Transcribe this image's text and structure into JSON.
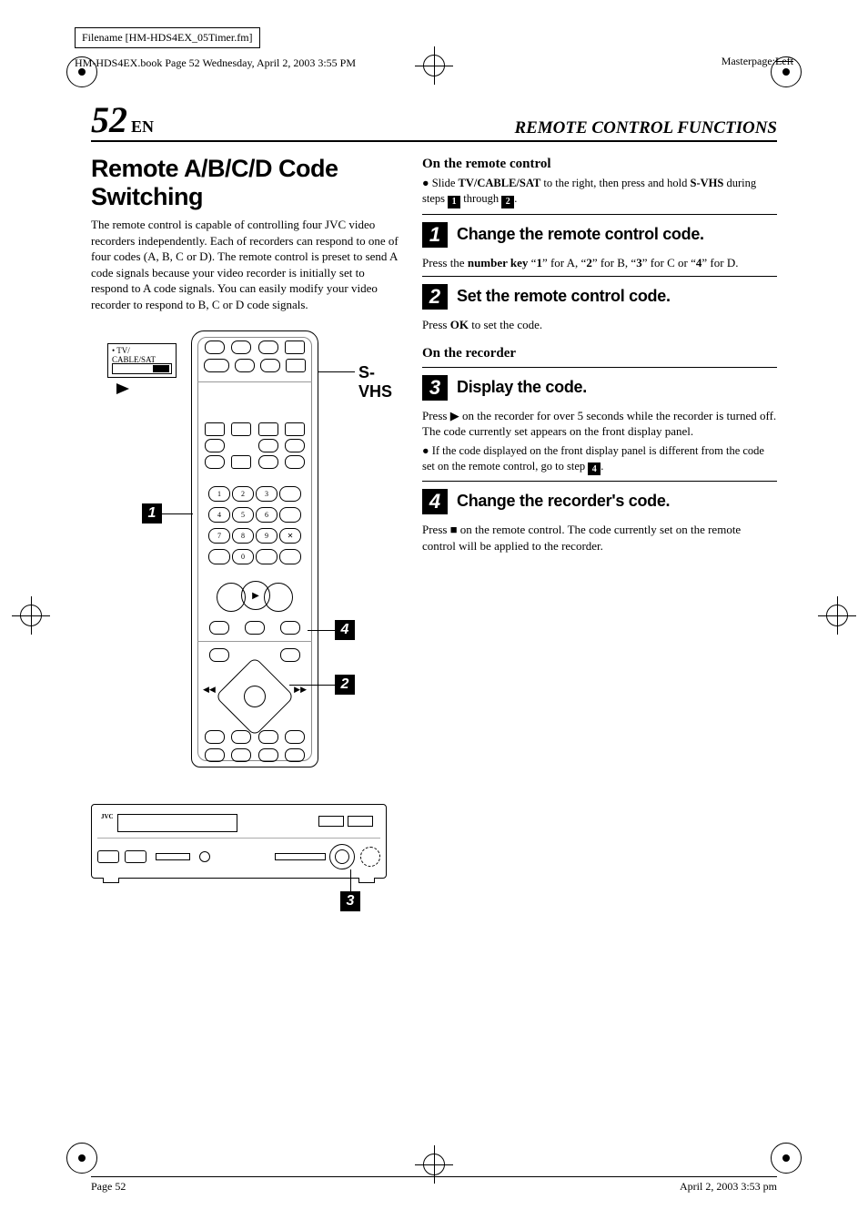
{
  "frame": {
    "filename_label": "Filename [HM-HDS4EX_05Timer.fm]",
    "book_line": "HM-HDS4EX.book  Page 52  Wednesday, April 2, 2003  3:55 PM",
    "masterpage": "Masterpage:",
    "masterpage_val": "Left"
  },
  "header": {
    "page_num": "52",
    "lang": "EN",
    "section": "REMOTE CONTROL FUNCTIONS"
  },
  "left": {
    "title": "Remote A/B/C/D Code Switching",
    "intro": "The remote control is capable of controlling four JVC video recorders independently. Each of recorders can respond to one of four codes (A, B, C or D). The remote control is preset to send A code signals because your video recorder is initially set to respond to A code signals. You can easily modify your video recorder to respond to B, C or D code signals.",
    "switch_label": "• TV/\nCABLE/SAT",
    "svhs_label": "S-VHS",
    "callout1": "1",
    "callout2": "2",
    "callout3": "3",
    "callout4": "4",
    "rec_brand": "JVC"
  },
  "right": {
    "sub_remote": "On the remote control",
    "slide_text_pre": "Slide ",
    "slide_bold": "TV/CABLE/SAT",
    "slide_text_mid": " to the right, then press and hold ",
    "slide_bold2": "S-VHS",
    "slide_text_post": " during steps ",
    "slide_end": " through ",
    "inline1": "1",
    "inline2": "2",
    "period": ".",
    "step1": {
      "num": "1",
      "title": "Change the remote control code.",
      "body_pre": "Press the ",
      "body_bold": "number key",
      "body_post": " “",
      "k1": "1",
      "a": "” for A, “",
      "k2": "2",
      "b": "” for B, “",
      "k3": "3",
      "c": "” for C or “",
      "k4": "4",
      "d": "” for D."
    },
    "step2": {
      "num": "2",
      "title": "Set the remote control code.",
      "body_pre": "Press ",
      "body_bold": "OK",
      "body_post": " to set the code."
    },
    "sub_recorder": "On the recorder",
    "step3": {
      "num": "3",
      "title": "Display the code.",
      "body": "Press ▶ on the recorder for over 5 seconds while the recorder is turned off. The code currently set appears on the front display panel.",
      "bullet": "If the code displayed on the front display panel is different from the code set on the remote control, go to step ",
      "bullet_num": "4",
      "bullet_end": "."
    },
    "step4": {
      "num": "4",
      "title": "Change the recorder's code.",
      "body": "Press ■ on the remote control. The code currently set on the remote control will be applied to the recorder."
    }
  },
  "footer": {
    "left": "Page 52",
    "right": "April 2, 2003 3:53 pm"
  }
}
